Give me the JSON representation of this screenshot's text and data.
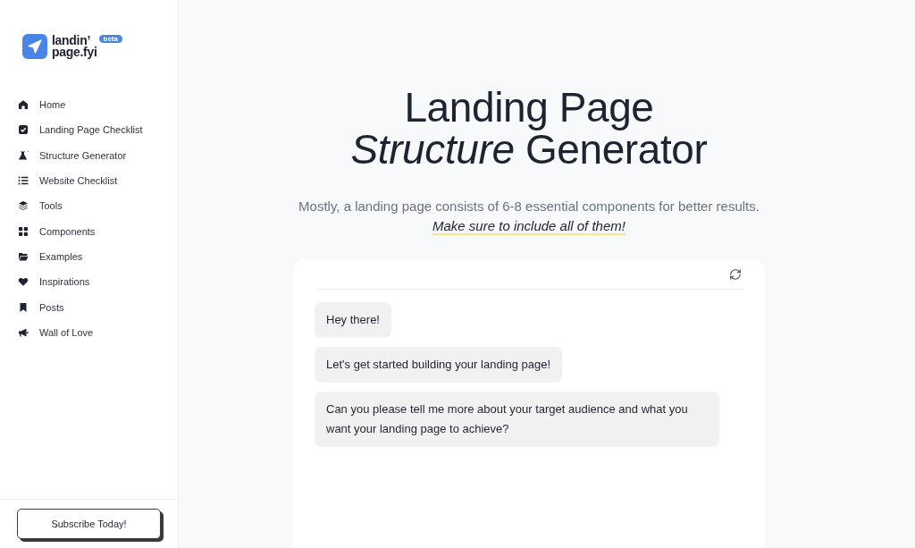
{
  "logo": {
    "name_lines": [
      "landin’",
      "page.fyi"
    ],
    "badge": "beta"
  },
  "sidebar": {
    "items": [
      {
        "label": "Home"
      },
      {
        "label": "Landing Page Checklist"
      },
      {
        "label": "Structure Generator"
      },
      {
        "label": "Website Checklist"
      },
      {
        "label": "Tools"
      },
      {
        "label": "Components"
      },
      {
        "label": "Examples"
      },
      {
        "label": "Inspirations"
      },
      {
        "label": "Posts"
      },
      {
        "label": "Wall of Love"
      }
    ],
    "subscribe_button": "Subscribe Today!"
  },
  "hero": {
    "title": "Landing Page *Structure* Generator",
    "subtitle": "Mostly, a landing page consists of 6-8 essential components for better results.",
    "emphasis": "Make sure to include all of them!"
  },
  "chat": {
    "messages": [
      {
        "text": "Hey there!"
      },
      {
        "text": "Let's get started building your landing page!"
      },
      {
        "text": "Can you please tell me more about your target audience and what you want your landing page to achieve?"
      }
    ]
  }
}
